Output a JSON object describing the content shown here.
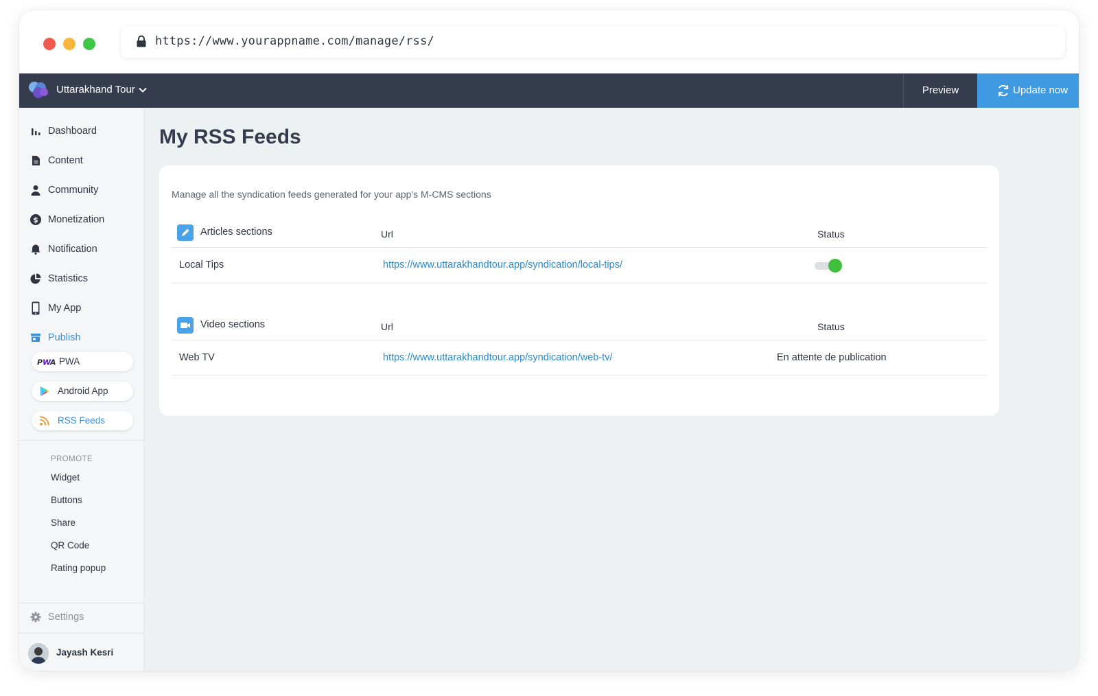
{
  "browser": {
    "url": "https://www.yourappname.com/manage/rss/"
  },
  "topbar": {
    "app_name": "Uttarakhand Tour",
    "preview_label": "Preview",
    "update_label": "Update now",
    "colors": {
      "bar": "#353c4d",
      "update": "#3f9ae2"
    }
  },
  "sidebar": {
    "items": [
      {
        "label": "Dashboard",
        "icon": "bar-chart-icon"
      },
      {
        "label": "Content",
        "icon": "document-icon"
      },
      {
        "label": "Community",
        "icon": "user-icon"
      },
      {
        "label": "Monetization",
        "icon": "dollar-icon"
      },
      {
        "label": "Notification",
        "icon": "bell-icon"
      },
      {
        "label": "Statistics",
        "icon": "pie-chart-icon"
      },
      {
        "label": "My App",
        "icon": "phone-icon"
      },
      {
        "label": "Publish",
        "icon": "store-icon",
        "active": true
      }
    ],
    "publish_sub": [
      {
        "label": "PWA",
        "icon": "pwa-icon"
      },
      {
        "label": "Android App",
        "icon": "play-store-icon"
      },
      {
        "label": "RSS Feeds",
        "icon": "rss-icon",
        "active": true
      }
    ],
    "promote_title": "PROMOTE",
    "promote_items": [
      "Widget",
      "Buttons",
      "Share",
      "QR Code",
      "Rating popup"
    ],
    "settings_label": "Settings",
    "user_name": "Jayash Kesri"
  },
  "main": {
    "title": "My RSS Feeds",
    "description": "Manage all the syndication feeds generated for your app's M-CMS sections",
    "sections": [
      {
        "title": "Articles sections",
        "icon": "pencil-icon",
        "url_header": "Url",
        "status_header": "Status",
        "rows": [
          {
            "name": "Local Tips",
            "url": "https://www.uttarakhandtour.app/syndication/local-tips/",
            "status": "on"
          }
        ]
      },
      {
        "title": "Video sections",
        "icon": "video-camera-icon",
        "url_header": "Url",
        "status_header": "Status",
        "rows": [
          {
            "name": "Web TV",
            "url": "https://www.uttarakhandtour.app/syndication/web-tv/",
            "status_text": "En attente de publication"
          }
        ]
      }
    ]
  }
}
